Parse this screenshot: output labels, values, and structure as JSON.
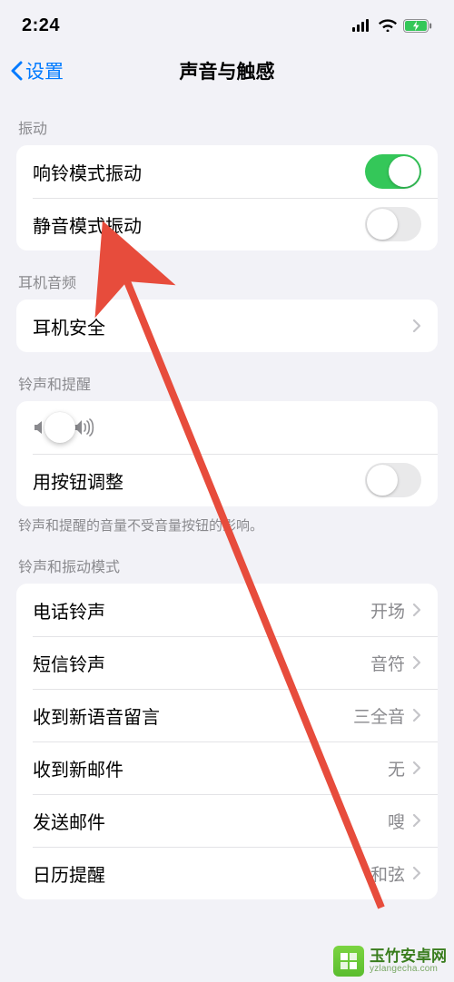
{
  "status": {
    "time": "2:24"
  },
  "nav": {
    "back": "设置",
    "title": "声音与触感"
  },
  "sections": {
    "vibrate": {
      "header": "振动",
      "ring_label": "响铃模式振动",
      "ring_on": true,
      "silent_label": "静音模式振动",
      "silent_on": false
    },
    "headphone": {
      "header": "耳机音频",
      "safety_label": "耳机安全"
    },
    "ringer": {
      "header": "铃声和提醒",
      "slider_value": 22,
      "button_adjust_label": "用按钮调整",
      "button_adjust_on": false,
      "footer": "铃声和提醒的音量不受音量按钮的影响。"
    },
    "patterns": {
      "header": "铃声和振动模式",
      "ringtone_label": "电话铃声",
      "ringtone_value": "开场",
      "text_label": "短信铃声",
      "text_value": "音符",
      "voicemail_label": "收到新语音留言",
      "voicemail_value": "三全音",
      "mail_label": "收到新邮件",
      "mail_value": "无",
      "sent_label": "发送邮件",
      "sent_value": "嗖",
      "calendar_label": "日历提醒",
      "calendar_value": "和弦"
    }
  },
  "watermark": {
    "cn": "玉竹安卓网",
    "url": "yzlangecha.com"
  }
}
